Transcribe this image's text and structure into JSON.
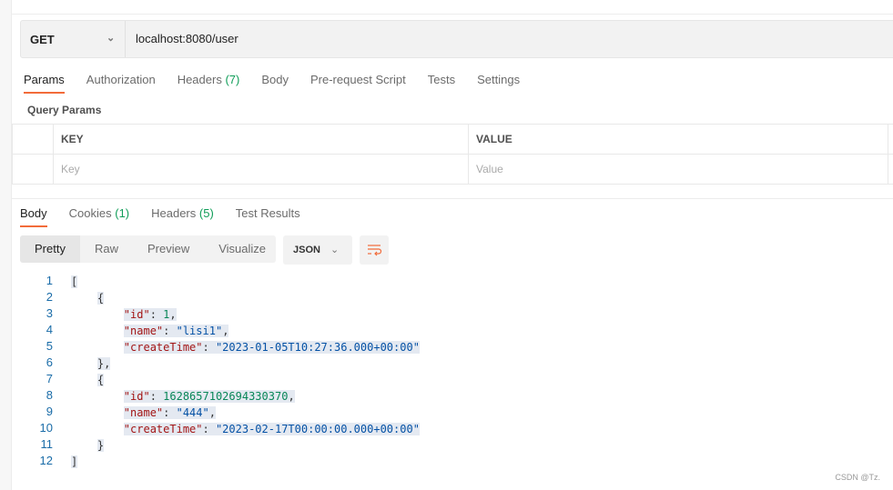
{
  "request": {
    "method": "GET",
    "url": "localhost:8080/user"
  },
  "request_tabs": [
    {
      "label": "Params",
      "active": true
    },
    {
      "label": "Authorization"
    },
    {
      "label": "Headers",
      "count": "(7)"
    },
    {
      "label": "Body"
    },
    {
      "label": "Pre-request Script"
    },
    {
      "label": "Tests"
    },
    {
      "label": "Settings"
    }
  ],
  "query_params": {
    "title": "Query Params",
    "headers": [
      "KEY",
      "VALUE"
    ],
    "key_placeholder": "Key",
    "value_placeholder": "Value"
  },
  "response_tabs": [
    {
      "label": "Body",
      "active": true
    },
    {
      "label": "Cookies",
      "count": "(1)"
    },
    {
      "label": "Headers",
      "count": "(5)"
    },
    {
      "label": "Test Results"
    }
  ],
  "view_modes": [
    "Pretty",
    "Raw",
    "Preview",
    "Visualize"
  ],
  "format": "JSON",
  "accent": "#f26b3a",
  "code_lines": [
    [
      [
        "p",
        "["
      ]
    ],
    [
      [
        "p",
        "    {"
      ]
    ],
    [
      [
        "k",
        "        \"id\""
      ],
      [
        "p",
        ": "
      ],
      [
        "n",
        "1"
      ],
      [
        "p",
        ","
      ]
    ],
    [
      [
        "k",
        "        \"name\""
      ],
      [
        "p",
        ": "
      ],
      [
        "s",
        "\"lisi1\""
      ],
      [
        "p",
        ","
      ]
    ],
    [
      [
        "k",
        "        \"createTime\""
      ],
      [
        "p",
        ": "
      ],
      [
        "s",
        "\"2023-01-05T10:27:36.000+00:00\""
      ]
    ],
    [
      [
        "p",
        "    },"
      ]
    ],
    [
      [
        "p",
        "    {"
      ]
    ],
    [
      [
        "k",
        "        \"id\""
      ],
      [
        "p",
        ": "
      ],
      [
        "n",
        "1628657102694330370"
      ],
      [
        "p",
        ","
      ]
    ],
    [
      [
        "k",
        "        \"name\""
      ],
      [
        "p",
        ": "
      ],
      [
        "s",
        "\"444\""
      ],
      [
        "p",
        ","
      ]
    ],
    [
      [
        "k",
        "        \"createTime\""
      ],
      [
        "p",
        ": "
      ],
      [
        "s",
        "\"2023-02-17T00:00:00.000+00:00\""
      ]
    ],
    [
      [
        "p",
        "    }"
      ]
    ],
    [
      [
        "p",
        "]"
      ]
    ]
  ],
  "watermark": "CSDN @Tz."
}
